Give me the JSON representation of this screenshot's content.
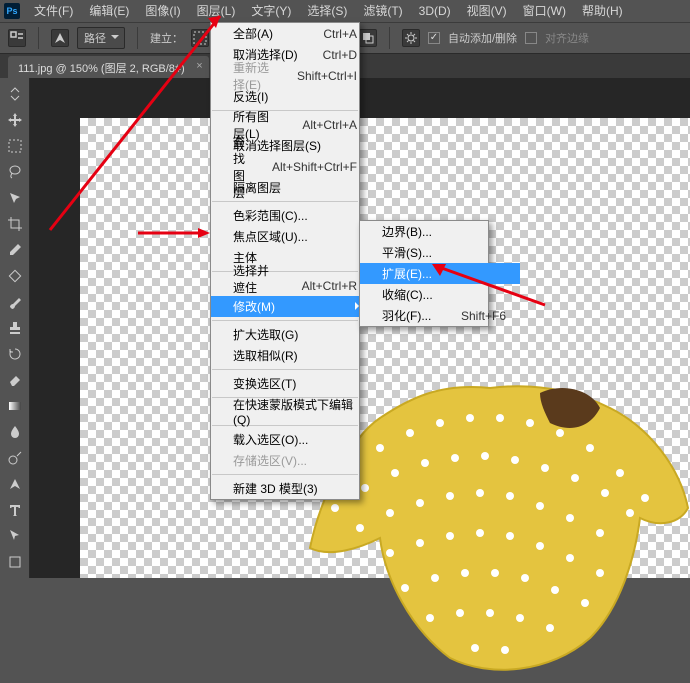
{
  "app": {
    "ps": "Ps"
  },
  "menubar": {
    "file": "文件(F)",
    "edit": "编辑(E)",
    "image": "图像(I)",
    "layer": "图层(L)",
    "type": "文字(Y)",
    "select": "选择(S)",
    "filter": "滤镜(T)",
    "threeD": "3D(D)",
    "view": "视图(V)",
    "window": "窗口(W)",
    "help": "帮助(H)"
  },
  "optbar": {
    "path": "路径",
    "build": "建立：",
    "auto": "自动添加/删除",
    "align": "对齐边缘"
  },
  "tab": {
    "title": "111.jpg @ 150% (图层 2, RGB/8#)"
  },
  "menu": {
    "all": "全部(A)",
    "all_sc": "Ctrl+A",
    "deselect": "取消选择(D)",
    "deselect_sc": "Ctrl+D",
    "reselect": "重新选择(E)",
    "reselect_sc": "Shift+Ctrl+I",
    "inverse": "反选(I)",
    "allLayers": "所有图层(L)",
    "allLayers_sc": "Alt+Ctrl+A",
    "deselectLayers": "取消选择图层(S)",
    "findLayers": "查找图层",
    "findLayers_sc": "Alt+Shift+Ctrl+F",
    "isolateLayers": "隔离图层",
    "colorRange": "色彩范围(C)...",
    "focusArea": "焦点区域(U)...",
    "subject": "主体",
    "selectAndMask": "选择并遮住(K)...",
    "selectAndMask_sc": "Alt+Ctrl+R",
    "modify": "修改(M)",
    "grow": "扩大选取(G)",
    "similar": "选取相似(R)",
    "transform": "变换选区(T)",
    "quickMask": "在快速蒙版模式下编辑(Q)",
    "load": "载入选区(O)...",
    "save": "存储选区(V)...",
    "new3d": "新建 3D 模型(3)"
  },
  "submenu": {
    "border": "边界(B)...",
    "smooth": "平滑(S)...",
    "expand": "扩展(E)...",
    "contract": "收缩(C)...",
    "feather": "羽化(F)...",
    "feather_sc": "Shift+F6"
  }
}
